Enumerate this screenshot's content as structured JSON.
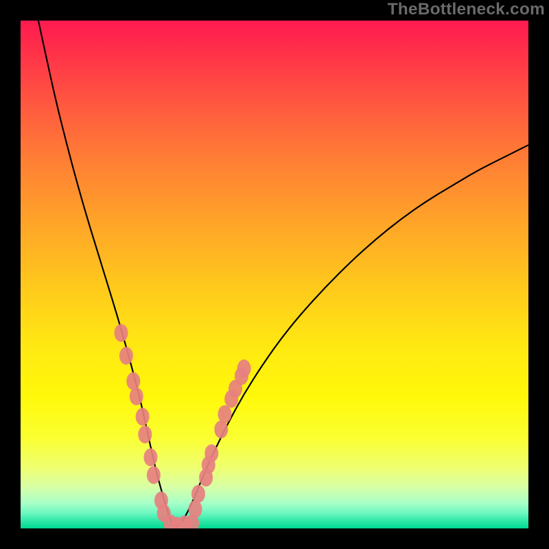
{
  "watermark": "TheBottleneck.com",
  "chart_data": {
    "type": "line",
    "title": "",
    "xlabel": "",
    "ylabel": "",
    "xlim": [
      0,
      100
    ],
    "ylim": [
      0,
      100
    ],
    "grid": false,
    "legend": false,
    "series": [
      {
        "name": "bottleneck-curve",
        "x": [
          3.5,
          5,
          7,
          9,
          11,
          13,
          15,
          17,
          19,
          21,
          22.5,
          24,
          25.3,
          26.5,
          28,
          29.2,
          30,
          31,
          32,
          34,
          36,
          38.5,
          41,
          44,
          47.5,
          51,
          55,
          60,
          65,
          70,
          75,
          80,
          85,
          90,
          95,
          100
        ],
        "values": [
          100,
          93,
          84,
          76,
          68.5,
          61.5,
          55,
          48.5,
          42,
          35,
          29.5,
          23.5,
          17.5,
          12,
          6.5,
          2.5,
          0.5,
          0.3,
          1.5,
          5.5,
          10.5,
          16,
          21,
          26.5,
          32,
          37,
          42,
          47.5,
          52.5,
          57,
          61,
          64.5,
          67.5,
          70.5,
          73,
          75.5
        ]
      }
    ],
    "markers": {
      "name": "highlighted-points",
      "points": [
        {
          "x": 19.8,
          "y": 38.5
        },
        {
          "x": 20.8,
          "y": 34.0
        },
        {
          "x": 22.2,
          "y": 29.0
        },
        {
          "x": 22.8,
          "y": 26.0
        },
        {
          "x": 24.0,
          "y": 22.0
        },
        {
          "x": 24.5,
          "y": 18.5
        },
        {
          "x": 25.6,
          "y": 14.0
        },
        {
          "x": 26.2,
          "y": 10.5
        },
        {
          "x": 27.7,
          "y": 5.5
        },
        {
          "x": 28.2,
          "y": 3.0
        },
        {
          "x": 29.5,
          "y": 1.0
        },
        {
          "x": 30.8,
          "y": 0.5
        },
        {
          "x": 32.3,
          "y": 0.8
        },
        {
          "x": 33.8,
          "y": 1.0
        },
        {
          "x": 34.4,
          "y": 3.8
        },
        {
          "x": 35.0,
          "y": 6.8
        },
        {
          "x": 36.5,
          "y": 10.0
        },
        {
          "x": 37.0,
          "y": 12.5
        },
        {
          "x": 37.6,
          "y": 14.8
        },
        {
          "x": 39.5,
          "y": 19.5
        },
        {
          "x": 40.2,
          "y": 22.5
        },
        {
          "x": 41.5,
          "y": 25.5
        },
        {
          "x": 42.3,
          "y": 27.5
        },
        {
          "x": 43.5,
          "y": 30.0
        },
        {
          "x": 44.0,
          "y": 31.5
        }
      ]
    }
  }
}
